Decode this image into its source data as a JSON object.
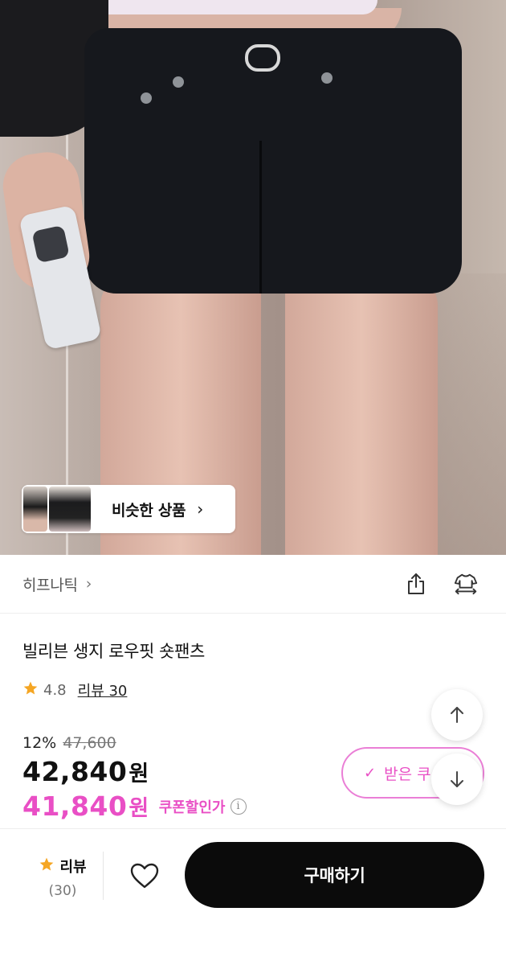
{
  "similar": {
    "label": "비슷한 상품",
    "chevron": "›"
  },
  "brand": {
    "name": "히프나틱",
    "chevron": "›",
    "icons": [
      "share-icon",
      "fitting-icon"
    ]
  },
  "product": {
    "title": "빌리븐 생지 로우핏 숏팬츠",
    "rating": "4.8",
    "review_link": "리뷰 30",
    "discount_rate": "12%",
    "original_price": "47,600",
    "price": "42,840",
    "price_unit": "원",
    "coupon_price": "41,840",
    "coupon_price_unit": "원",
    "coupon_label": "쿠폰할인가",
    "info_icon": "i"
  },
  "coupon_button": {
    "check": "✓",
    "label": "받은 쿠"
  },
  "bottom_bar": {
    "review_label": "리뷰",
    "review_count": "(30)",
    "buy_label": "구매하기"
  },
  "colors": {
    "accent_pink": "#e94fc5",
    "star": "#f5a623",
    "buy_button": "#0b0b0b"
  }
}
